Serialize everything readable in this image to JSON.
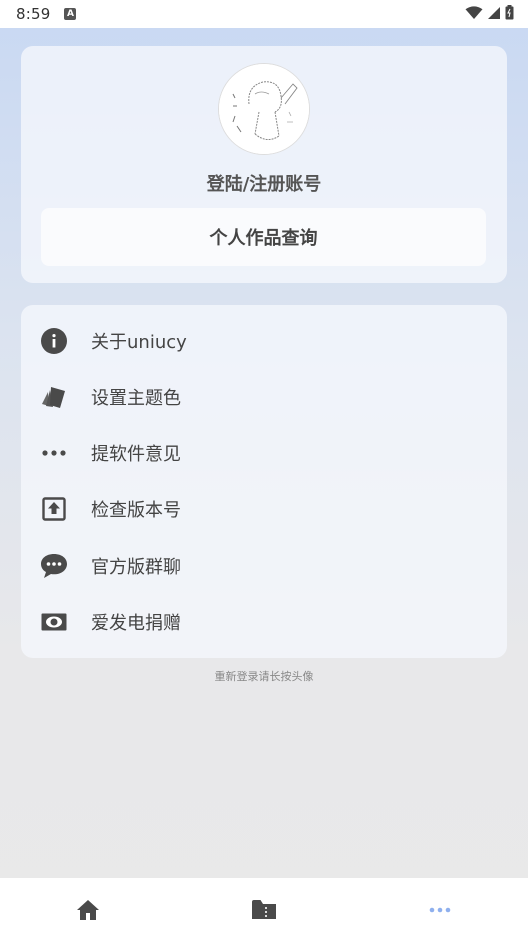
{
  "status_bar": {
    "time": "8:59",
    "app_icon_glyph": "A",
    "icons": [
      "wifi-icon",
      "signal-icon",
      "battery-icon"
    ]
  },
  "profile": {
    "login_label": "登陆/注册账号",
    "works_button_label": "个人作品查询"
  },
  "menu": {
    "items": [
      {
        "label": "关于uniucy",
        "icon": "info-icon"
      },
      {
        "label": "设置主题色",
        "icon": "palette-icon"
      },
      {
        "label": "提软件意见",
        "icon": "more-dots-icon"
      },
      {
        "label": "检查版本号",
        "icon": "upload-box-icon"
      },
      {
        "label": "官方版群聊",
        "icon": "chat-bubble-icon"
      },
      {
        "label": "爱发电捐赠",
        "icon": "money-icon"
      }
    ]
  },
  "hint": "重新登录请长按头像",
  "bottom_nav": {
    "items": [
      {
        "name": "home",
        "icon": "home-icon",
        "active": false
      },
      {
        "name": "folder",
        "icon": "folder-icon",
        "active": false
      },
      {
        "name": "more",
        "icon": "more-dots-icon",
        "active": true
      }
    ]
  },
  "colors": {
    "icon": "#4a4a4a",
    "active_nav": "#8fb0ee",
    "status_bar_bg": "#ffffff",
    "nav_bg": "#ffffff"
  }
}
